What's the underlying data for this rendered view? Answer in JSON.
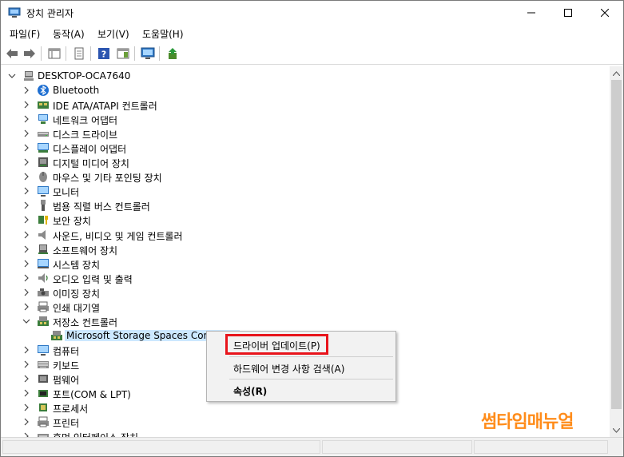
{
  "window": {
    "title": "장치 관리자"
  },
  "menu": [
    "파일(F)",
    "동작(A)",
    "보기(V)",
    "도움말(H)"
  ],
  "tree": {
    "root": "DESKTOP-OCA7640",
    "items": [
      {
        "label": "Bluetooth",
        "icon": "bluetooth-icon"
      },
      {
        "label": "IDE ATA/ATAPI 컨트롤러",
        "icon": "ide-controller-icon"
      },
      {
        "label": "네트워크 어댑터",
        "icon": "network-adapter-icon"
      },
      {
        "label": "디스크 드라이브",
        "icon": "disk-drive-icon"
      },
      {
        "label": "디스플레이 어댑터",
        "icon": "display-adapter-icon"
      },
      {
        "label": "디지털 미디어 장치",
        "icon": "digital-media-icon"
      },
      {
        "label": "마우스 및 기타 포인팅 장치",
        "icon": "mouse-icon"
      },
      {
        "label": "모니터",
        "icon": "monitor-icon"
      },
      {
        "label": "범용 직렬 버스 컨트롤러",
        "icon": "usb-icon"
      },
      {
        "label": "보안 장치",
        "icon": "security-device-icon"
      },
      {
        "label": "사운드, 비디오 및 게임 컨트롤러",
        "icon": "speaker-icon"
      },
      {
        "label": "소프트웨어 장치",
        "icon": "software-device-icon"
      },
      {
        "label": "시스템 장치",
        "icon": "system-device-icon"
      },
      {
        "label": "오디오 입력 및 출력",
        "icon": "audio-io-icon"
      },
      {
        "label": "이미징 장치",
        "icon": "imaging-device-icon"
      },
      {
        "label": "인쇄 대기열",
        "icon": "print-queue-icon"
      },
      {
        "label": "저장소 컨트롤러",
        "icon": "storage-controller-icon"
      },
      {
        "label": "Microsoft Storage Spaces Controller",
        "icon": "storage-controller-icon"
      },
      {
        "label": "컴퓨터",
        "icon": "computer-icon"
      },
      {
        "label": "키보드",
        "icon": "keyboard-icon"
      },
      {
        "label": "펌웨어",
        "icon": "firmware-icon"
      },
      {
        "label": "포트(COM & LPT)",
        "icon": "port-icon"
      },
      {
        "label": "프로세서",
        "icon": "processor-icon"
      },
      {
        "label": "프린터",
        "icon": "printer-icon"
      },
      {
        "label": "휴먼 인터페이스 장치",
        "icon": "hid-icon"
      }
    ]
  },
  "context_menu": {
    "update_driver": "드라이버 업데이트(P)",
    "scan_hardware": "하드웨어 변경 사항 검색(A)",
    "properties": "속성(R)"
  },
  "watermark": "썸타임매뉴얼",
  "colors": {
    "highlight": "#e8141b",
    "watermark": "#ff8c1a",
    "selection": "#cce8ff"
  }
}
